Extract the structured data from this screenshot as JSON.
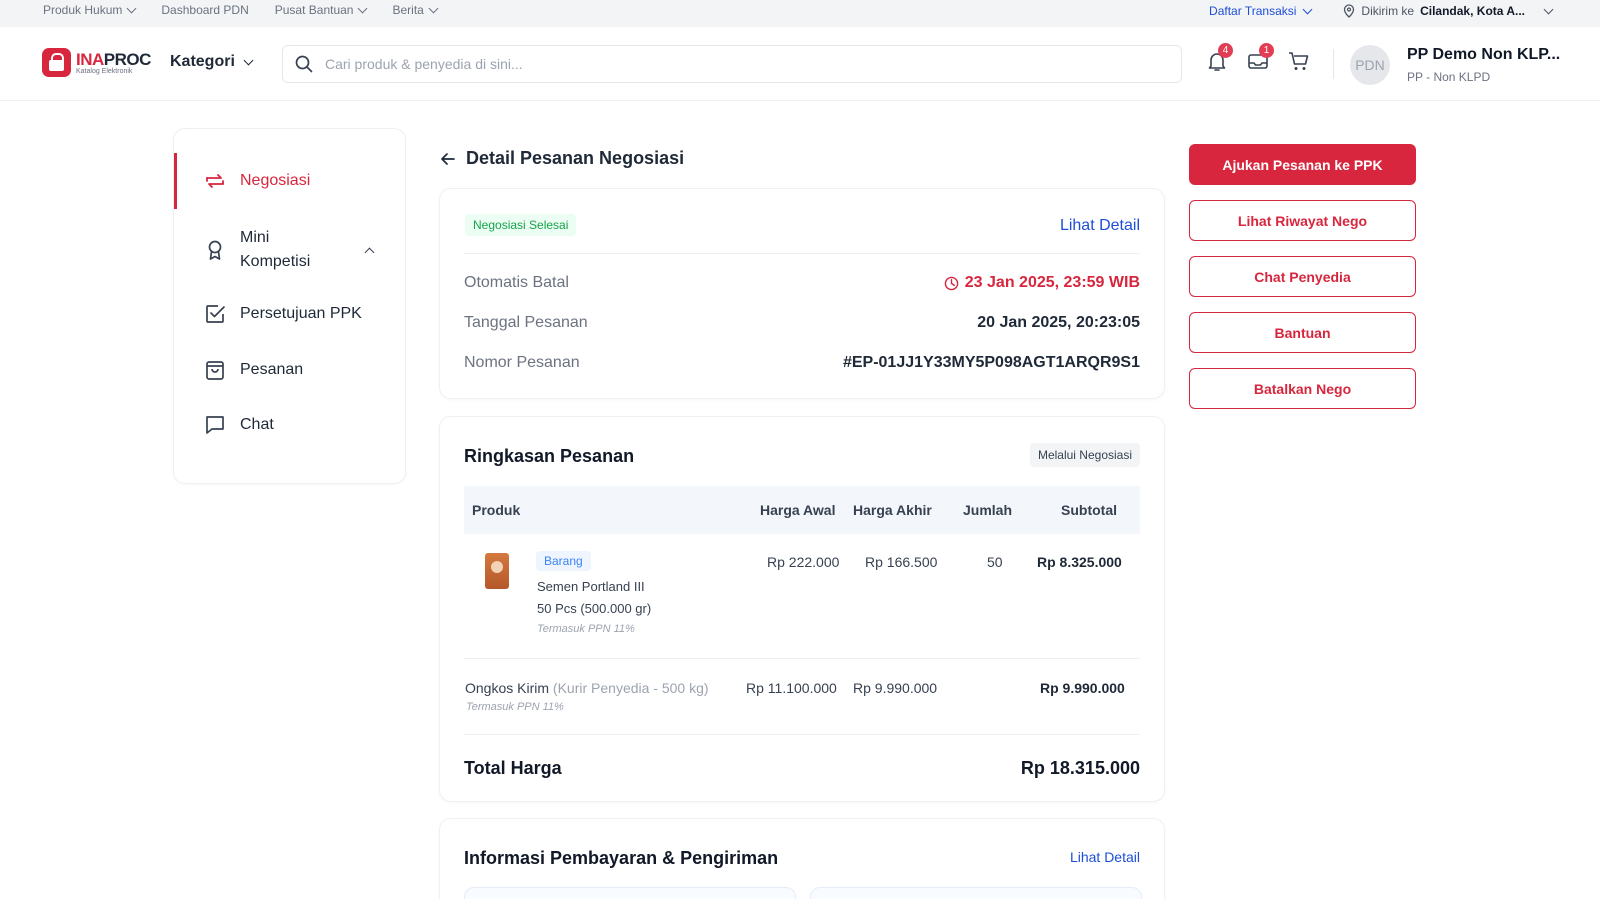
{
  "topbar": {
    "left_items": [
      "Produk Hukum",
      "Dashboard PDN",
      "Pusat Bantuan",
      "Berita"
    ],
    "daftar_transaksi": "Daftar Transaksi",
    "dikirim_label": "Dikirim ke",
    "dikirim_value": "Cilandak, Kota A..."
  },
  "header": {
    "logo_name_a": "INA",
    "logo_name_b": "PROC",
    "logo_sub": "Katalog Elektronik",
    "kategori": "Kategori",
    "search_placeholder": "Cari produk & penyedia di sini...",
    "notif_count": "4",
    "mail_count": "1",
    "avatar_initials": "PDN",
    "user_name": "PP Demo Non KLP...",
    "user_role": "PP - Non KLPD"
  },
  "sidebar": {
    "items": [
      {
        "label": "Negosiasi"
      },
      {
        "label": "Mini Kompetisi"
      },
      {
        "label": "Persetujuan PPK"
      },
      {
        "label": "Pesanan"
      },
      {
        "label": "Chat"
      }
    ]
  },
  "page": {
    "title": "Detail Pesanan Negosiasi"
  },
  "status_card": {
    "status": "Negosiasi Selesai",
    "detail_link": "Lihat Detail",
    "rows": [
      {
        "label": "Otomatis Batal",
        "value": "23 Jan 2025, 23:59 WIB"
      },
      {
        "label": "Tanggal Pesanan",
        "value": "20 Jan 2025, 20:23:05"
      },
      {
        "label": "Nomor Pesanan",
        "value": "#EP-01JJ1Y33MY5P098AGT1ARQR9S1"
      }
    ]
  },
  "summary": {
    "title": "Ringkasan Pesanan",
    "tag": "Melalui Negosiasi",
    "columns": [
      "Produk",
      "Harga Awal",
      "Harga Akhir",
      "Jumlah",
      "Subtotal"
    ],
    "product": {
      "type": "Barang",
      "name": "Semen Portland III",
      "qty_detail": "50 Pcs (500.000 gr)",
      "tax_note": "Termasuk PPN 11%",
      "harga_awal": "Rp 222.000",
      "harga_akhir": "Rp 166.500",
      "jumlah": "50",
      "subtotal": "Rp 8.325.000"
    },
    "shipping": {
      "label": "Ongkos Kirim",
      "detail": "(Kurir Penyedia - 500 kg)",
      "tax_note": "Termasuk PPN 11%",
      "harga_awal": "Rp 11.100.000",
      "harga_akhir": "Rp 9.990.000",
      "subtotal": "Rp 9.990.000"
    },
    "total_label": "Total Harga",
    "total_value": "Rp 18.315.000"
  },
  "payment": {
    "title": "Informasi Pembayaran & Pengiriman",
    "detail_link": "Lihat Detail"
  },
  "actions": {
    "primary": "Ajukan Pesanan ke PPK",
    "riwayat": "Lihat Riwayat Nego",
    "chat": "Chat Penyedia",
    "bantuan": "Bantuan",
    "batalkan": "Batalkan Nego"
  },
  "colors": {
    "brand": "#d7263d",
    "link": "#1d4ed8",
    "success": "#16a34a"
  }
}
